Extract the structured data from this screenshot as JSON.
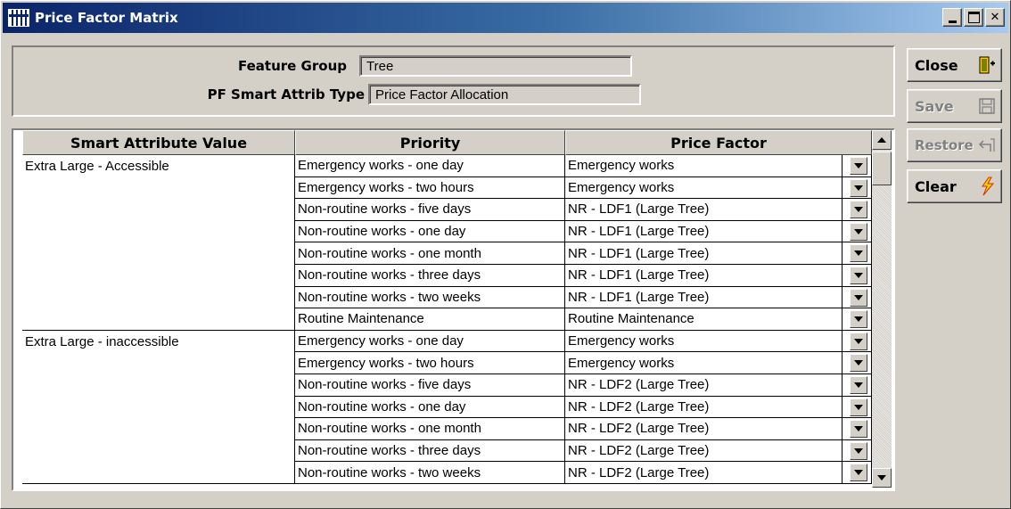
{
  "window": {
    "title": "Price Factor Matrix"
  },
  "header": {
    "feature_group_label": "Feature Group",
    "feature_group_value": "Tree",
    "pf_type_label": "PF Smart Attrib Type",
    "pf_type_value": "Price Factor Allocation"
  },
  "buttons": {
    "close": "Close",
    "save": "Save",
    "restore": "Restore",
    "clear": "Clear"
  },
  "grid": {
    "columns": [
      "Smart Attribute Value",
      "Priority",
      "Price Factor"
    ],
    "rows": [
      {
        "sav": "Extra Large - Accessible",
        "priority": "Emergency works - one day",
        "price_factor": "Emergency works"
      },
      {
        "sav": "",
        "priority": "Emergency works - two hours",
        "price_factor": "Emergency works"
      },
      {
        "sav": "",
        "priority": "Non-routine works - five days",
        "price_factor": "NR - LDF1 (Large Tree)"
      },
      {
        "sav": "",
        "priority": "Non-routine works - one day",
        "price_factor": "NR - LDF1 (Large Tree)"
      },
      {
        "sav": "",
        "priority": "Non-routine works - one month",
        "price_factor": "NR - LDF1 (Large Tree)"
      },
      {
        "sav": "",
        "priority": "Non-routine works - three days",
        "price_factor": "NR - LDF1 (Large Tree)"
      },
      {
        "sav": "",
        "priority": "Non-routine works - two weeks",
        "price_factor": "NR - LDF1 (Large Tree)"
      },
      {
        "sav": "",
        "priority": "Routine Maintenance",
        "price_factor": "Routine Maintenance"
      },
      {
        "sav": "Extra Large - inaccessible",
        "priority": "Emergency works - one day",
        "price_factor": "Emergency works"
      },
      {
        "sav": "",
        "priority": "Emergency works - two hours",
        "price_factor": "Emergency works"
      },
      {
        "sav": "",
        "priority": "Non-routine works - five days",
        "price_factor": "NR - LDF2 (Large Tree)"
      },
      {
        "sav": "",
        "priority": "Non-routine works - one day",
        "price_factor": "NR - LDF2 (Large Tree)"
      },
      {
        "sav": "",
        "priority": "Non-routine works - one month",
        "price_factor": "NR - LDF2 (Large Tree)"
      },
      {
        "sav": "",
        "priority": "Non-routine works - three days",
        "price_factor": "NR - LDF2 (Large Tree)"
      },
      {
        "sav": "",
        "priority": "Non-routine works - two weeks",
        "price_factor": "NR - LDF2 (Large Tree)"
      }
    ]
  },
  "icons": {
    "app": "grid-app-icon",
    "close": "exit-door-icon",
    "save": "floppy-disk-icon",
    "restore": "undo-arrow-icon",
    "clear": "eraser-lightning-icon"
  }
}
